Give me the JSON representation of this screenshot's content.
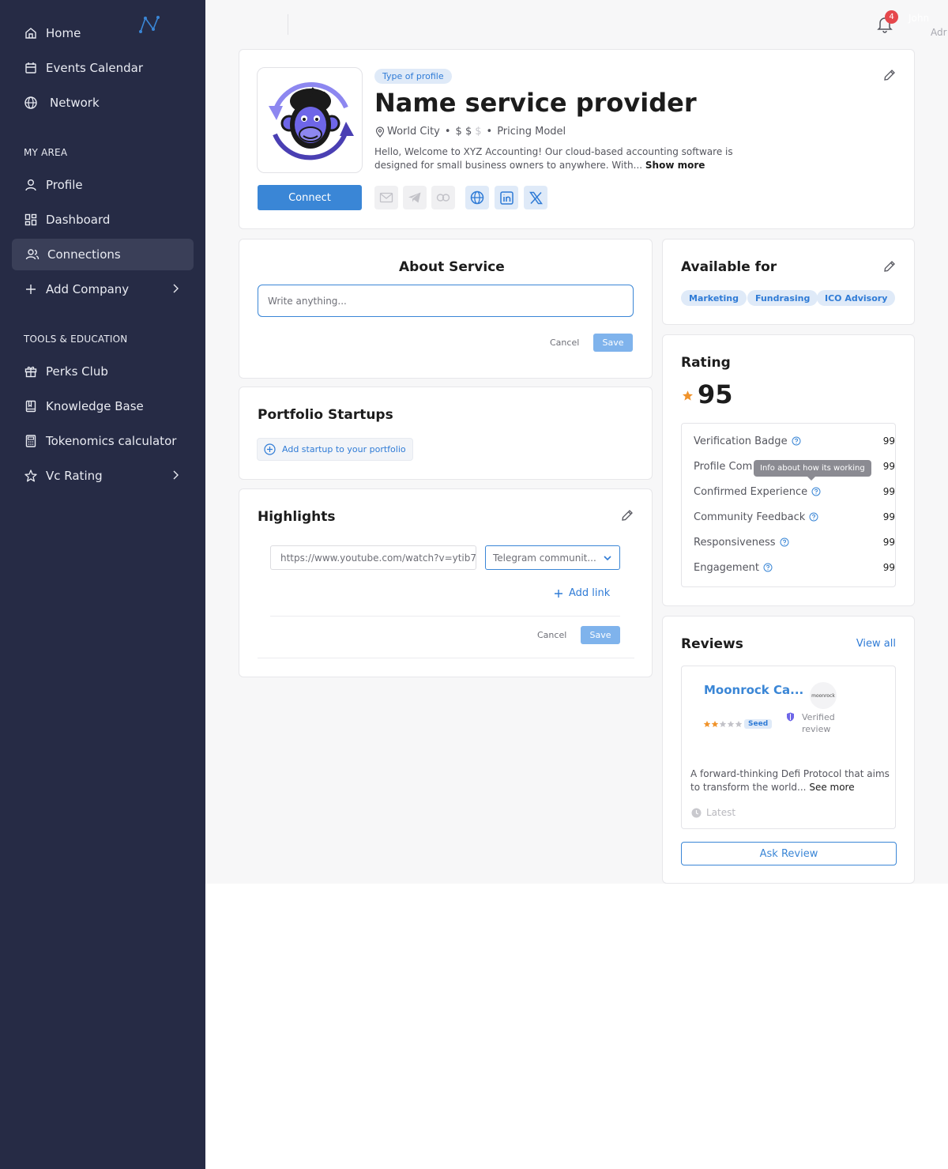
{
  "sidebar": {
    "items": [
      {
        "label": "Home",
        "icon": "home-icon"
      },
      {
        "label": "Events Calendar",
        "icon": "calendar-icon"
      },
      {
        "label": "Network",
        "icon": "globe-icon"
      },
      {
        "label": "Profile",
        "icon": "user-icon"
      },
      {
        "label": "Dashboard",
        "icon": "dashboard-icon"
      },
      {
        "label": "Connections",
        "icon": "users-icon"
      },
      {
        "label": "Add Company",
        "icon": "plus-icon"
      },
      {
        "label": "Perks Club",
        "icon": "gift-icon"
      },
      {
        "label": "Knowledge Base",
        "icon": "book-icon"
      },
      {
        "label": "Tokenomics calculator",
        "icon": "calculator-icon"
      },
      {
        "label": "Vc Rating",
        "icon": "star-icon"
      }
    ],
    "sections": {
      "my_area": "MY AREA",
      "tools": "TOOLS & EDUCATION"
    },
    "active_item": "Connections"
  },
  "topbar": {
    "notifications_count": "4",
    "user_name": "John",
    "user_role": "Adr"
  },
  "profile": {
    "type_tag": "Type of profile",
    "title": "Name service provider",
    "location": "World City",
    "price_active": "$ $",
    "price_inactive": "$",
    "pricing_model": "Pricing Model",
    "description": "Hello, Welcome to XYZ Accounting! Our cloud-based accounting software is designed for small business owners to  anywhere. With...",
    "show_more": "Show more",
    "connect_label": "Connect"
  },
  "about": {
    "title": "About Service",
    "placeholder": "Write anything...",
    "cancel": "Cancel",
    "save": "Save"
  },
  "portfolio": {
    "title": "Portfolio Startups",
    "add_label": "Add startup to your portfolio"
  },
  "highlights": {
    "title": "Highlights",
    "link_value": "https://www.youtube.com/watch?v=ytib7",
    "select_value": "Telegram communit...",
    "add_link": "Add link",
    "cancel": "Cancel",
    "save": "Save"
  },
  "available": {
    "title": "Available for",
    "chips": [
      "Marketing",
      "Fundrasing",
      "ICO Advisory"
    ]
  },
  "rating": {
    "title": "Rating",
    "score": "95",
    "rows": [
      {
        "label": "Verification Badge",
        "value": "99"
      },
      {
        "label": "Profile Com",
        "value": "99"
      },
      {
        "label": "Confirmed Experience",
        "value": "99"
      },
      {
        "label": "Community Feedback",
        "value": "99"
      },
      {
        "label": "Responsiveness",
        "value": "99"
      },
      {
        "label": "Engagement",
        "value": "99"
      }
    ],
    "tooltip": "Info about how its working"
  },
  "reviews": {
    "title": "Reviews",
    "view_all": "View all",
    "item": {
      "name": "Moonrock Ca...",
      "logo_text": "moonrock",
      "stars": 2,
      "stage": "Seed",
      "verified": "Verified review",
      "text": "A forward-thinking Defi Protocol that aims to transform the world...",
      "see_more": "See more",
      "latest": "Latest"
    },
    "ask_review": "Ask Review"
  },
  "colors": {
    "sidebar_bg": "#262b45",
    "accent": "#3a86d6",
    "chip_bg": "#dfeaf8",
    "badge_red": "#e5484d",
    "star_orange": "#f0932b"
  }
}
